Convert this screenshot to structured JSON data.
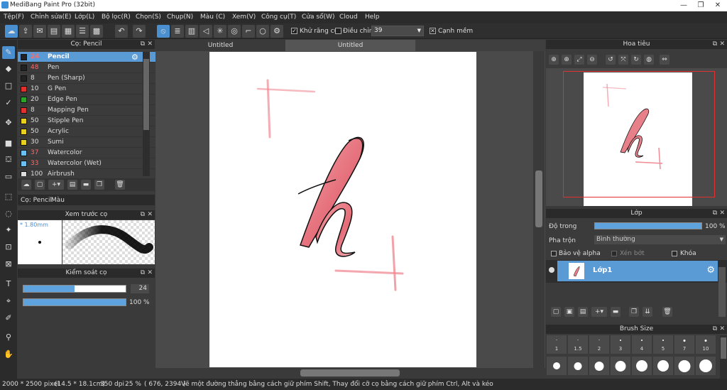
{
  "window": {
    "title": "MediBang Paint Pro (32bit)",
    "min": "—",
    "max": "❐",
    "close": "✕"
  },
  "menu": [
    "Tệp(F)",
    "Chỉnh sửa(E)",
    "Lớp(L)",
    "Bộ lọc(R)",
    "Chọn(S)",
    "Chụp(N)",
    "Màu (C)",
    "Xem(V)",
    "Công cụ(T)",
    "Cửa sổ(W)",
    "Cloud",
    "Help"
  ],
  "toolbar": {
    "antialias_label": "Khử răng cưa",
    "smoothing_label": "Điều chỉnh",
    "smoothing_value": "39",
    "snap_label": "Cạnh mềm"
  },
  "brush_panel": {
    "title": "Cọ: Pencil",
    "items": [
      {
        "size": "24",
        "name": "Pencil",
        "color": "#222222"
      },
      {
        "size": "48",
        "name": "Pen",
        "color": "#222222"
      },
      {
        "size": "8",
        "name": "Pen (Sharp)",
        "color": "#222222"
      },
      {
        "size": "10",
        "name": "G Pen",
        "color": "#e03030"
      },
      {
        "size": "20",
        "name": "Edge Pen",
        "color": "#2aa52a"
      },
      {
        "size": "8",
        "name": "Mapping Pen",
        "color": "#e03030"
      },
      {
        "size": "50",
        "name": "Stipple Pen",
        "color": "#e8d020"
      },
      {
        "size": "50",
        "name": "Acrylic",
        "color": "#e8d020"
      },
      {
        "size": "30",
        "name": "Sumi",
        "color": "#e8d020"
      },
      {
        "size": "37",
        "name": "Watercolor",
        "color": "#6ac0f0"
      },
      {
        "size": "33",
        "name": "Watercolor (Wet)",
        "color": "#6ac0f0"
      },
      {
        "size": "100",
        "name": "Airbrush",
        "color": "#dddddd"
      }
    ],
    "tabs": [
      "Cọ: Pencil",
      "Màu"
    ]
  },
  "brush_preview": {
    "title": "Xem trước cọ",
    "size_label": "* 1.80mm"
  },
  "brush_control": {
    "title": "Kiểm soát cọ",
    "size_value": "24",
    "opacity_value": "100 %",
    "size_fraction": 0.5,
    "opacity_fraction": 1.0
  },
  "documents": {
    "tab1": "Untitled",
    "tab2": "Untitled"
  },
  "navigator": {
    "title": "Hoa tiêu"
  },
  "layer_panel": {
    "title": "Lớp",
    "opacity_label": "Độ trong",
    "opacity_value": "100 %",
    "blend_label": "Pha trộn",
    "blend_value": "Bình thường",
    "protect_alpha": "Bảo vệ alpha",
    "clipping": "Xén bớt",
    "lock": "Khóa",
    "layer_name": "Lớp1"
  },
  "brush_size_panel": {
    "title": "Brush Size",
    "sizes": [
      "1",
      "1.5",
      "2",
      "3",
      "4",
      "5",
      "7",
      "10"
    ]
  },
  "status": {
    "dimensions": "2000 * 2500 pixel",
    "physical": "(14.5 * 18.1cm)",
    "dpi": "350 dpi",
    "zoom": "25 %",
    "coords": "( 676, 2394 )",
    "hint": "Vẽ một đường thẳng bằng cách giữ phím Shift, Thay đổi cỡ cọ bằng cách giữ phím Ctrl, Alt và kéo"
  },
  "colors": {
    "accent": "#5b9bd5",
    "ink": "#111111",
    "brush_pink": "#e87a84"
  }
}
